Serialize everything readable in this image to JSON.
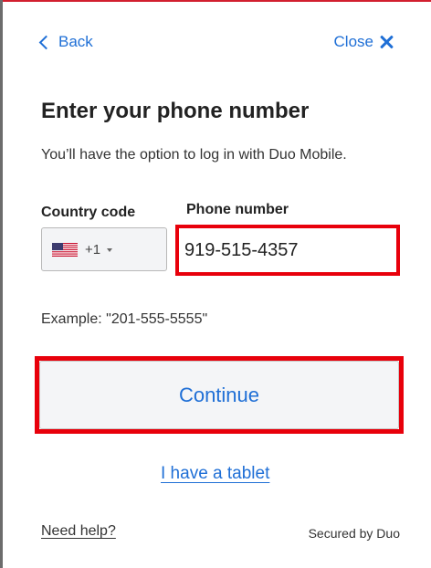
{
  "nav": {
    "back_label": "Back",
    "close_label": "Close"
  },
  "main": {
    "title": "Enter your phone number",
    "subtitle": "You’ll have the option to log in with Duo Mobile.",
    "country_code_label": "Country code",
    "phone_number_label": "Phone number",
    "country": {
      "flag": "us-flag-icon",
      "dial_code": "+1"
    },
    "phone_number_value": "919-515-4357",
    "example": "Example: \"201-555-5555\"",
    "continue_label": "Continue",
    "tablet_link": "I have a tablet"
  },
  "footer": {
    "help_link": "Need help?",
    "secured_text": "Secured by Duo"
  },
  "colors": {
    "link_blue": "#1f6fd6",
    "highlight_red": "#e8000b",
    "button_bg": "#f4f5f7"
  }
}
